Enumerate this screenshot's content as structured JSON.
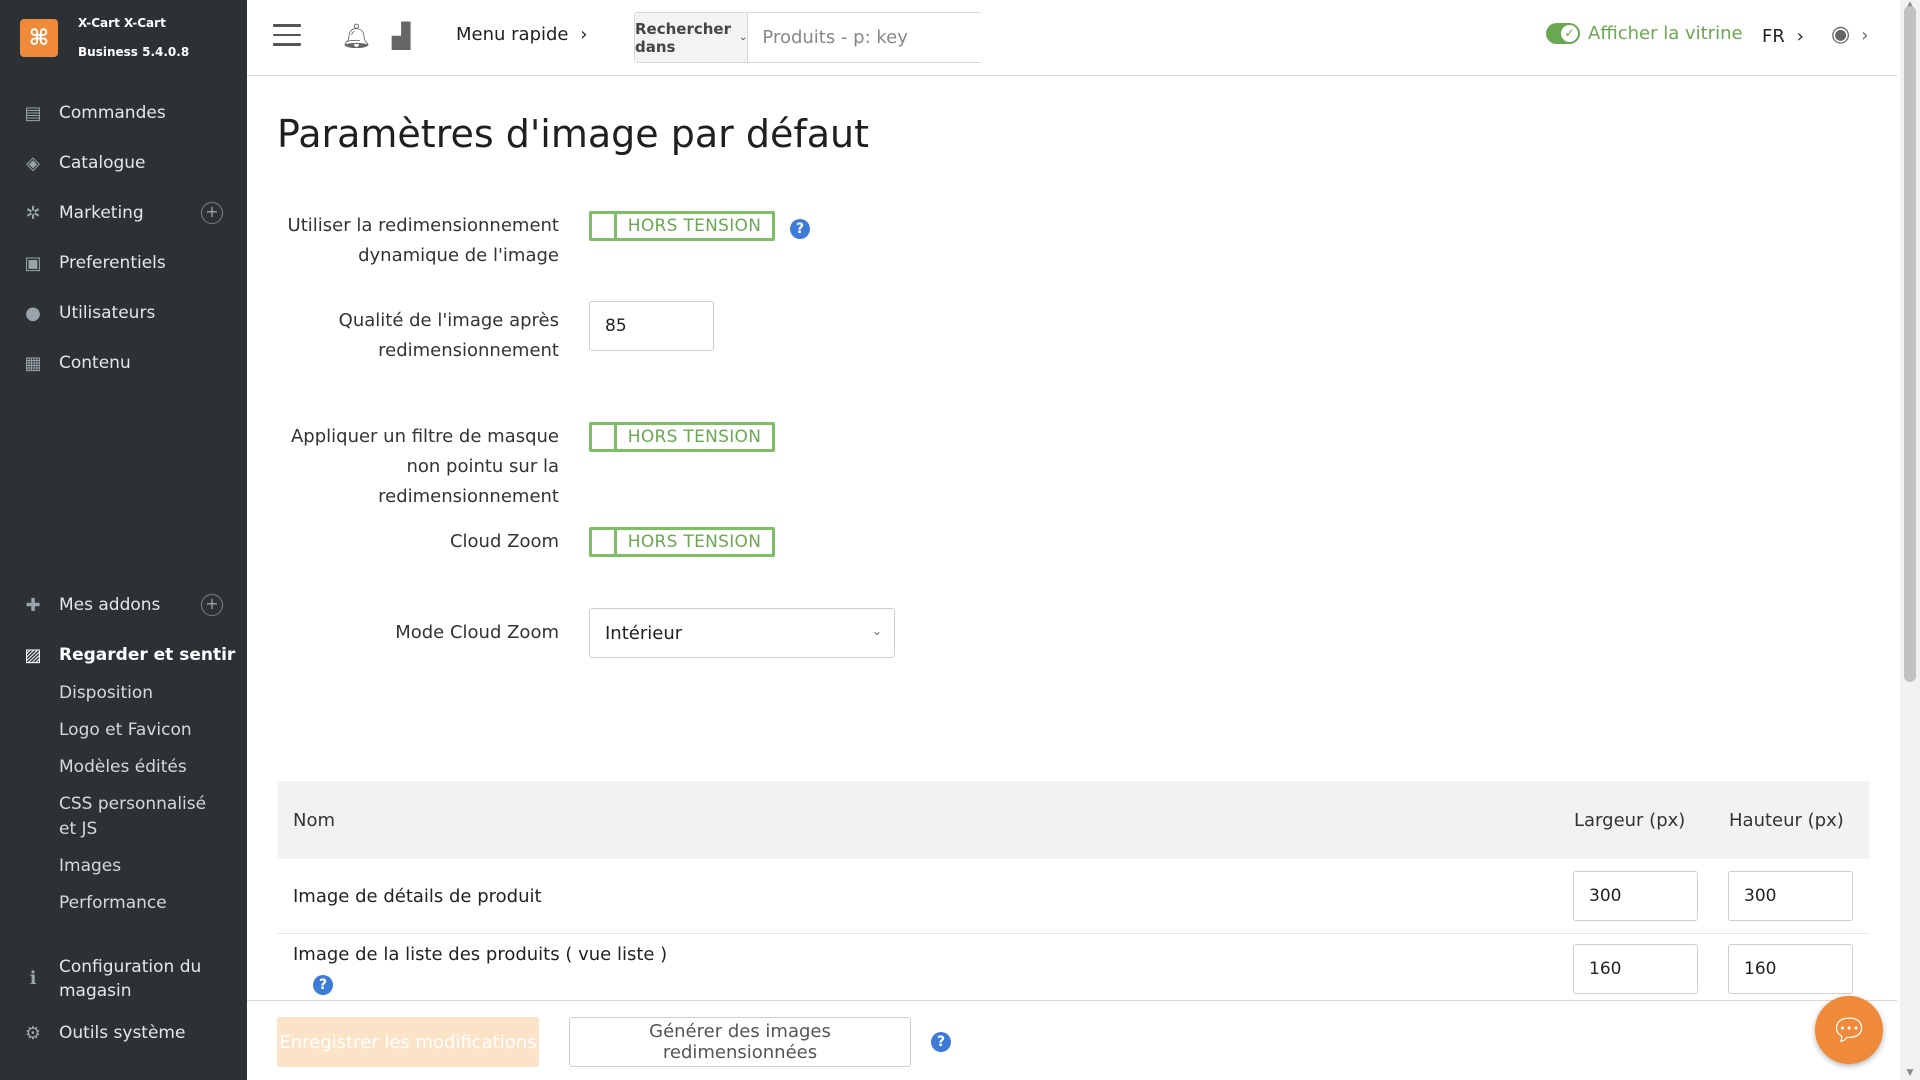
{
  "colors": {
    "sidebar_bg": "#2b3135",
    "accent": "#ef8a3a",
    "toggle_green": "#6aa84f",
    "help_blue": "#3d7bd6"
  },
  "brand": {
    "line1": "X-Cart X-Cart",
    "line2": "Business 5.4.0.8"
  },
  "sidebar": {
    "items": [
      {
        "label": "Commandes",
        "icon": "orders-icon"
      },
      {
        "label": "Catalogue",
        "icon": "tags-icon"
      },
      {
        "label": "Marketing",
        "icon": "marketing-icon"
      },
      {
        "label": "Preferentiels",
        "icon": "gift-icon"
      },
      {
        "label": "Utilisateurs",
        "icon": "users-icon"
      },
      {
        "label": "Contenu",
        "icon": "content-icon"
      },
      {
        "label": "Mes addons",
        "icon": "puzzle-icon"
      },
      {
        "label": "Regarder et sentir",
        "icon": "image-icon"
      }
    ],
    "subitems": [
      "Disposition",
      "Logo et Favicon",
      "Modèles édités",
      "CSS personnalisé et JS",
      "Images",
      "Performance"
    ],
    "bottom_items": [
      {
        "label": "Configuration du magasin",
        "icon": "info-icon"
      },
      {
        "label": "Outils système",
        "icon": "gear-icon"
      }
    ]
  },
  "topbar": {
    "quick_menu": "Menu rapide",
    "search_select": "Rechercher dans",
    "search_placeholder": "Produits - p: key",
    "storefront_label": "Afficher la vitrine",
    "lang": "FR"
  },
  "main": {
    "title": "Paramètres d'image par défaut",
    "fields": {
      "dynamic_resize": {
        "label": "Utiliser la redimensionnement dynamique de l'image",
        "state": "HORS TENSION"
      },
      "quality": {
        "label": "Qualité de l'image après redimensionnement",
        "value": "85"
      },
      "unsharp": {
        "label": "Appliquer un filtre de masque non pointu sur la redimensionnement",
        "state": "HORS TENSION"
      },
      "cloud_zoom": {
        "label": "Cloud Zoom",
        "state": "HORS TENSION"
      },
      "cloud_zoom_mode": {
        "label": "Mode Cloud Zoom",
        "value": "Intérieur"
      }
    },
    "table": {
      "headers": {
        "name": "Nom",
        "width": "Largeur (px)",
        "height": "Hauteur (px)"
      },
      "rows": [
        {
          "name": "Image de détails de produit",
          "width": "300",
          "height": "300"
        },
        {
          "name": "Image de la liste des produits ( vue liste )",
          "width": "160",
          "height": "160"
        }
      ]
    }
  },
  "bottombar": {
    "save_label": "Enregistrer les modifications",
    "generate_label": "Générer des images redimensionnées"
  }
}
